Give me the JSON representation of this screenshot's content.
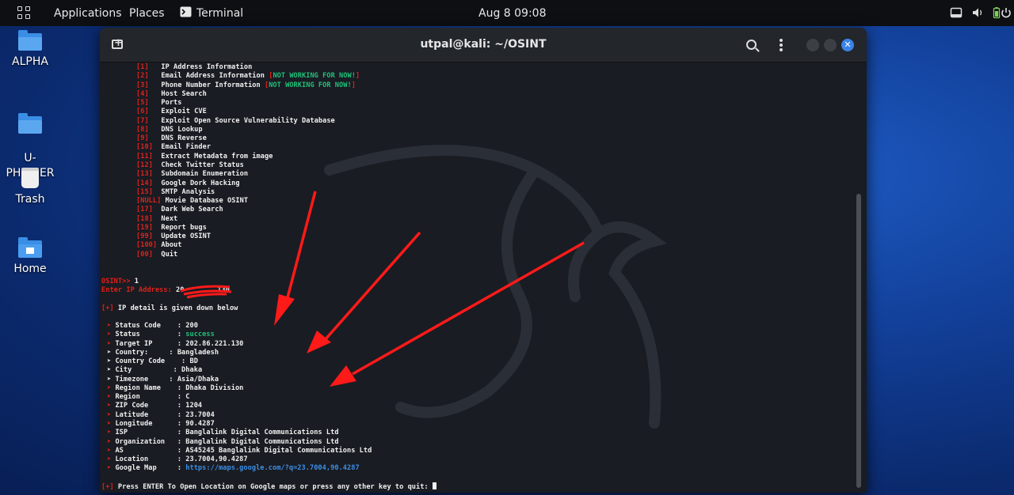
{
  "topbar": {
    "applications": "Applications",
    "places": "Places",
    "terminal": "Terminal",
    "clock": "Aug 8  09:08",
    "icons": [
      "apps-grid-icon",
      "terminal-icon",
      "window-icon",
      "volume-icon",
      "battery-icon",
      "power-icon"
    ]
  },
  "desktop": {
    "icons": [
      {
        "label": "ALPHA",
        "icon": "folder-icon"
      },
      {
        "label": "U-\nPHISHER",
        "icon": "folder-icon"
      },
      {
        "label": "Trash",
        "icon": "trash-icon"
      },
      {
        "label": "Home",
        "icon": "home-folder-icon"
      }
    ]
  },
  "terminal": {
    "title": "utpal@kali: ~/OSINT",
    "menu": [
      {
        "num": "1",
        "label": "IP Address Information",
        "note": ""
      },
      {
        "num": "2",
        "label": "Email Address Information",
        "note": "NOT WORKING FOR NOW!"
      },
      {
        "num": "3",
        "label": "Phone Number Information",
        "note": "NOT WORKING FOR NOW!"
      },
      {
        "num": "4",
        "label": "Host Search",
        "note": ""
      },
      {
        "num": "5",
        "label": "Ports",
        "note": ""
      },
      {
        "num": "6",
        "label": "Exploit CVE",
        "note": ""
      },
      {
        "num": "7",
        "label": "Exploit Open Source Vulnerability Database",
        "note": ""
      },
      {
        "num": "8",
        "label": "DNS Lookup",
        "note": ""
      },
      {
        "num": "9",
        "label": "DNS Reverse",
        "note": ""
      },
      {
        "num": "10",
        "label": "Email Finder",
        "note": ""
      },
      {
        "num": "11",
        "label": "Extract Metadata from image",
        "note": ""
      },
      {
        "num": "12",
        "label": "Check Twitter Status",
        "note": ""
      },
      {
        "num": "13",
        "label": "Subdomain Enumeration",
        "note": ""
      },
      {
        "num": "14",
        "label": "Google Dork Hacking",
        "note": ""
      },
      {
        "num": "15",
        "label": "SMTP Analysis",
        "note": ""
      },
      {
        "num": "NULL",
        "label": "Movie Database OSINT",
        "note": ""
      },
      {
        "num": "17",
        "label": "Dark Web Search",
        "note": ""
      },
      {
        "num": "18",
        "label": "Next",
        "note": ""
      },
      {
        "num": "19",
        "label": "Report bugs",
        "note": ""
      },
      {
        "num": "99",
        "label": "Update OSINT",
        "note": ""
      },
      {
        "num": "100",
        "label": "About",
        "note": ""
      },
      {
        "num": "00",
        "label": "Quit",
        "note": ""
      }
    ],
    "prompt": "OSINT>>",
    "choice": "1",
    "ip_prompt": "Enter IP Address:",
    "ip_visible_start": "20",
    "ip_visible_end": "130",
    "detail_marker": "[+]",
    "detail_header": "IP detail is given down below",
    "details": [
      {
        "k": "Status Code    ",
        "v": "200",
        "c": "r"
      },
      {
        "k": "Status         ",
        "v": "success",
        "c": "r",
        "vc": "g"
      },
      {
        "k": "Target IP      ",
        "v": "202.86.221.130",
        "c": "r"
      },
      {
        "k": "Country:     ",
        "v": "Bangladesh",
        "c": "w"
      },
      {
        "k": "Country Code    ",
        "v": "BD",
        "c": "w"
      },
      {
        "k": "City          ",
        "v": "Dhaka",
        "c": "w"
      },
      {
        "k": "Timezone     ",
        "v": "Asia/Dhaka",
        "c": "w"
      },
      {
        "k": "Region Name    ",
        "v": "Dhaka Division",
        "c": "r"
      },
      {
        "k": "Region         ",
        "v": "C",
        "c": "r"
      },
      {
        "k": "ZIP Code       ",
        "v": "1204",
        "c": "r"
      },
      {
        "k": "Latitude       ",
        "v": "23.7004",
        "c": "r"
      },
      {
        "k": "Longitude      ",
        "v": "90.4287",
        "c": "r"
      },
      {
        "k": "ISP            ",
        "v": "Banglalink Digital Communications Ltd",
        "c": "r"
      },
      {
        "k": "Organization   ",
        "v": "Banglalink Digital Communications Ltd",
        "c": "r"
      },
      {
        "k": "AS             ",
        "v": "AS45245 Banglalink Digital Communications Ltd",
        "c": "r"
      },
      {
        "k": "Location       ",
        "v": "23.7004,90.4287",
        "c": "r"
      },
      {
        "k": "Google Map     ",
        "v": "https://maps.google.com/?q=23.7004,90.4287",
        "c": "r",
        "vc": "b"
      }
    ],
    "final_prompt": "Press ENTER To Open Location on Google maps or press any other key to quit:"
  },
  "colors": {
    "accent_red": "#e0201c",
    "success_green": "#21c07a",
    "link_blue": "#3b8ee8",
    "terminal_bg": "#191c22",
    "annotation_arrow": "#ff1a1a"
  }
}
